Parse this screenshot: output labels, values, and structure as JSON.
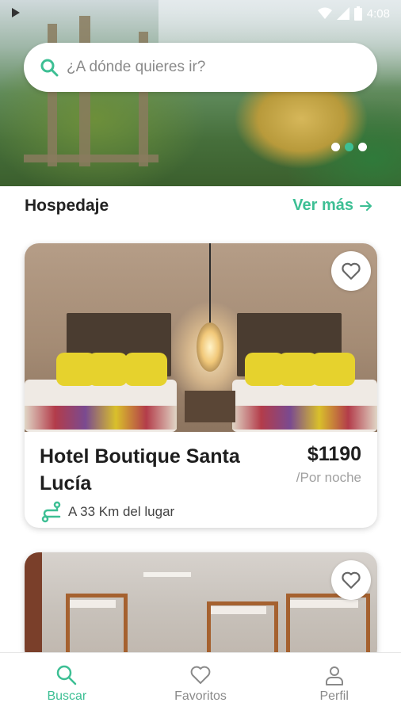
{
  "status_bar": {
    "time": "4:08"
  },
  "search": {
    "placeholder": "¿A dónde quieres ir?"
  },
  "carousel": {
    "total": 3,
    "active": 2
  },
  "section": {
    "title": "Hospedaje",
    "see_more": "Ver más"
  },
  "listings": [
    {
      "name": "Hotel Boutique Santa Lucía",
      "price": "$1190",
      "per": "/Por noche",
      "distance": "A 33 Km del lugar"
    }
  ],
  "bottom_nav": [
    {
      "label": "Buscar",
      "icon": "search-icon",
      "active": true
    },
    {
      "label": "Favoritos",
      "icon": "heart-icon",
      "active": false
    },
    {
      "label": "Perfil",
      "icon": "person-icon",
      "active": false
    }
  ],
  "colors": {
    "accent": "#3dbf94",
    "text": "#1e1e1e",
    "muted": "#a0a0a0"
  }
}
